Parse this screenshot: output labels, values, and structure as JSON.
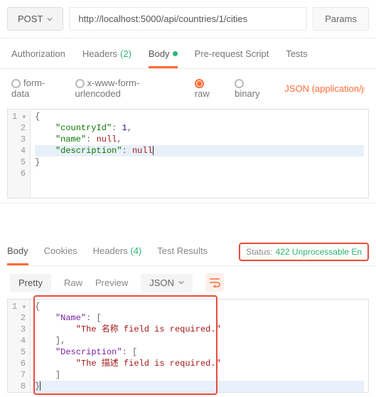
{
  "request": {
    "method": "POST",
    "url": "http://localhost:5000/api/countries/1/cities",
    "params_label": "Params"
  },
  "req_tabs": {
    "authorization": "Authorization",
    "headers": "Headers",
    "headers_count": "(2)",
    "body": "Body",
    "prerequest": "Pre-request Script",
    "tests": "Tests"
  },
  "body_types": {
    "formdata": "form-data",
    "urlencoded": "x-www-form-urlencoded",
    "raw": "raw",
    "binary": "binary",
    "json_link": "JSON (application/js"
  },
  "req_body_lines": [
    {
      "n": "1",
      "pre": "",
      "tokens": [
        {
          "t": "{",
          "c": ""
        }
      ]
    },
    {
      "n": "2",
      "pre": "    ",
      "tokens": [
        {
          "t": "\"countryId\"",
          "c": "str"
        },
        {
          "t": ": ",
          "c": ""
        },
        {
          "t": "1",
          "c": "num"
        },
        {
          "t": ",",
          "c": ""
        }
      ]
    },
    {
      "n": "3",
      "pre": "    ",
      "tokens": [
        {
          "t": "\"name\"",
          "c": "str"
        },
        {
          "t": ": ",
          "c": ""
        },
        {
          "t": "null",
          "c": "null"
        },
        {
          "t": ",",
          "c": ""
        }
      ]
    },
    {
      "n": "4",
      "pre": "    ",
      "tokens": [
        {
          "t": "\"description\"",
          "c": "str"
        },
        {
          "t": ": ",
          "c": ""
        },
        {
          "t": "null",
          "c": "null"
        }
      ],
      "hl": true,
      "cursor": true
    },
    {
      "n": "5",
      "pre": "",
      "tokens": [
        {
          "t": "}",
          "c": ""
        }
      ]
    },
    {
      "n": "6",
      "pre": "",
      "tokens": []
    }
  ],
  "resp_tabs": {
    "body": "Body",
    "cookies": "Cookies",
    "headers": "Headers",
    "headers_count": "(4)",
    "tests": "Test Results"
  },
  "status": {
    "label": "Status:",
    "value": "422 Unprocessable En"
  },
  "view_modes": {
    "pretty": "Pretty",
    "raw": "Raw",
    "preview": "Preview",
    "format": "JSON"
  },
  "resp_body_lines": [
    {
      "n": "1",
      "pre": "",
      "tokens": [
        {
          "t": "{",
          "c": ""
        }
      ]
    },
    {
      "n": "2",
      "pre": "    ",
      "tokens": [
        {
          "t": "\"Name\"",
          "c": "key2"
        },
        {
          "t": ": [",
          "c": ""
        }
      ]
    },
    {
      "n": "3",
      "pre": "        ",
      "tokens": [
        {
          "t": "\"The 名称 field is required.\"",
          "c": "str2"
        }
      ]
    },
    {
      "n": "4",
      "pre": "    ",
      "tokens": [
        {
          "t": "],",
          "c": ""
        }
      ]
    },
    {
      "n": "5",
      "pre": "    ",
      "tokens": [
        {
          "t": "\"Description\"",
          "c": "key2"
        },
        {
          "t": ": [",
          "c": ""
        }
      ]
    },
    {
      "n": "6",
      "pre": "        ",
      "tokens": [
        {
          "t": "\"The 描述 field is required.\"",
          "c": "str2"
        }
      ]
    },
    {
      "n": "7",
      "pre": "    ",
      "tokens": [
        {
          "t": "]",
          "c": ""
        }
      ]
    },
    {
      "n": "8",
      "pre": "",
      "tokens": [
        {
          "t": "}",
          "c": ""
        }
      ],
      "hl": true,
      "cursor": true
    }
  ]
}
